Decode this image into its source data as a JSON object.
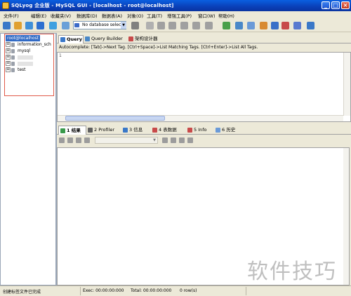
{
  "window": {
    "title": "SQLyog 企业版 - MySQL GUI - [localhost - root@localhost]",
    "controls": {
      "minimize": "_",
      "maximize": "□",
      "close": "×"
    }
  },
  "menu": [
    "文件(F)",
    "编辑(E)",
    "收藏夹(V)",
    "数据库(D)",
    "数据表(A)",
    "对象(O)",
    "工具(T)",
    "增强工具(P)",
    "窗口(W)",
    "帮助(H)"
  ],
  "toolbar": {
    "db_select_value": "No database select",
    "icon_colors": [
      "#3a78c8",
      "#e0a030",
      "#3f8fd8",
      "#2d6fd0",
      "#3fa0e0",
      "#6aa0d8",
      "#808080",
      "#b0b0b0",
      "#a0a0a0",
      "#a0a0a0",
      "#a0a0a0",
      "#a0a0a0",
      "#a0a0a0",
      "#4aa04a",
      "#4a88c8",
      "#6a9ad8",
      "#d88a30",
      "#3a70c8",
      "#c84a4a",
      "#5a7ad0"
    ]
  },
  "object_browser": {
    "root": "root@localhost",
    "items": [
      {
        "label": "information_sch",
        "expander": "⊞"
      },
      {
        "label": "mysql",
        "expander": "⊞"
      },
      {
        "label": "",
        "expander": "⊞"
      },
      {
        "label": "",
        "expander": "⊞"
      },
      {
        "label": "test",
        "expander": "⊞"
      }
    ]
  },
  "query_tabs": [
    {
      "label": "Query",
      "active": true,
      "icon_color": "#3a78c8"
    },
    {
      "label": "Query Builder",
      "active": false,
      "icon_color": "#4a88c8"
    },
    {
      "label": "架构设计器",
      "active": false,
      "icon_color": "#c84a4a"
    }
  ],
  "autocomplete_hint": "Autocomplete: [Tab]->Next Tag. [Ctrl+Space]->List Matching Tags. [Ctrl+Enter]->List All Tags.",
  "editor": {
    "line_number": "1"
  },
  "result_tabs": [
    {
      "label": "1 结果",
      "active": true,
      "icon_color": "#3a9a4a"
    },
    {
      "label": "2 Profiler",
      "active": false,
      "icon_color": "#606060"
    },
    {
      "label": "3 信息",
      "active": false,
      "icon_color": "#3a78c8"
    },
    {
      "label": "4 表数据",
      "active": false,
      "icon_color": "#c84a4a"
    },
    {
      "label": "5 Info",
      "active": false,
      "icon_color": "#c84a4a"
    },
    {
      "label": "6 历史",
      "active": false,
      "icon_color": "#6a9ad8"
    }
  ],
  "status": {
    "message": "创建标签文件已完成",
    "exec": "Exec: 00:00:00:000",
    "total": "Total: 00:00:00:000",
    "rows": "0 row(s)"
  },
  "watermark": "软件技巧"
}
